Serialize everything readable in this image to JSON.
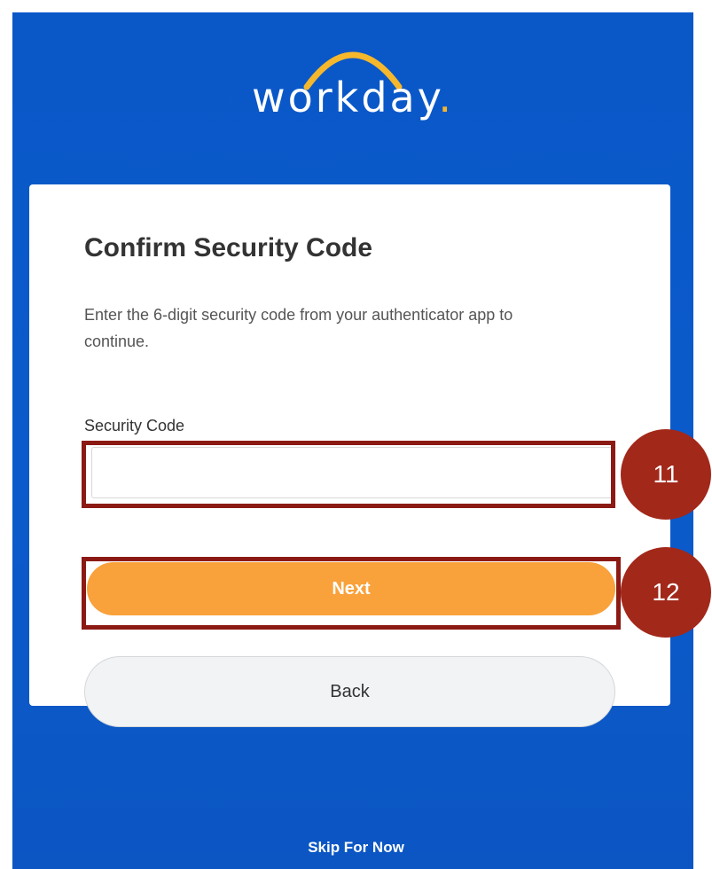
{
  "logo": {
    "text": "workday",
    "dot": ".",
    "arc_color": "#f5b72b"
  },
  "card": {
    "title": "Confirm Security Code",
    "description": "Enter the 6-digit security code from your authenticator app to continue.",
    "field_label": "Security Code",
    "field_value": "",
    "next_label": "Next",
    "back_label": "Back"
  },
  "skip_label": "Skip For Now",
  "annotations": {
    "step_11": "11",
    "step_12": "12"
  },
  "colors": {
    "background": "#0b5acb",
    "next_button": "#f9a13a",
    "back_button": "#f1f3f4",
    "highlight": "#8c1a14",
    "badge": "#a2281a"
  }
}
